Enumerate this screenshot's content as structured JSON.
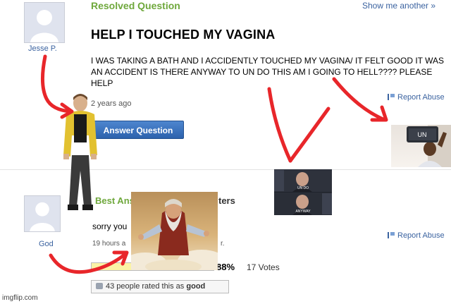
{
  "header": {
    "status": "Resolved Question",
    "show_more": "Show me another »"
  },
  "question": {
    "title": "HELP I TOUCHED MY VAGINA",
    "body": "I WAS TAKING A BATH AND I ACCIDENTLY TOUCHED MY VAGINA/ IT FELT GOOD IT WAS AN ACCIDENT IS THERE ANYWAY TO UN DO THIS AM I GOING TO HELL???? PLEASE HELP",
    "asker": "Jesse P.",
    "time_ago": "2 years ago",
    "answer_button": "Answer Question",
    "report_abuse": "Report Abuse"
  },
  "best_answer": {
    "heading_visible": "Best Ans",
    "heading_rest": "ters",
    "answerer": "God",
    "text": "sorry you",
    "time_ago": "19 hours a",
    "time_rest": "r.",
    "report_abuse": "Report Abuse",
    "rating_percent": "88%",
    "rating_fraction": 0.88,
    "votes": "17 Votes",
    "rated_prefix": "43 people rated this as",
    "rated_value": "good"
  },
  "overlays": {
    "jesse_label": "",
    "tv_sign": "UN",
    "tv_caption_top": "UN DO",
    "tv_caption_bottom": "ANYWAY"
  },
  "watermark": "imgflip.com",
  "colors": {
    "link": "#3b63a0",
    "green": "#6fa83c",
    "arrow": "#e8262a"
  }
}
